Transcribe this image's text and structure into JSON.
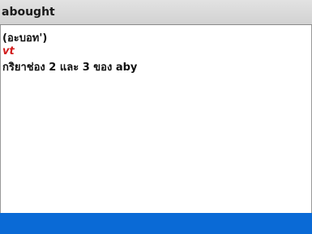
{
  "entry": {
    "headword": "abought",
    "pronunciation": "(อะบอท')",
    "part_of_speech": "vt",
    "definition": "กริยาช่อง 2 และ 3 ของ aby"
  },
  "colors": {
    "header_background": "#d8d8d8",
    "part_of_speech": "#d11a1a",
    "bottom_bar": "#0a6ad6"
  }
}
